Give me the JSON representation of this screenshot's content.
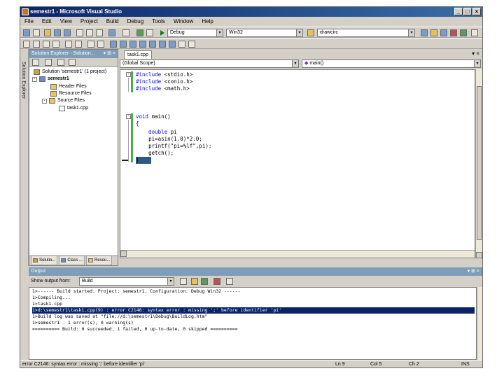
{
  "window": {
    "title": "semestr1 - Microsoft Visual Studio",
    "minimize": "_",
    "maximize": "□",
    "close": "×"
  },
  "menu": [
    "File",
    "Edit",
    "View",
    "Project",
    "Build",
    "Debug",
    "Tools",
    "Window",
    "Help"
  ],
  "toolbar": {
    "configuration": "Debug",
    "platform": "Win32",
    "find_value": "drawcirc"
  },
  "sidebar_tab": "Solution Explorer",
  "solution_explorer": {
    "title": "Solution Explorer - Solution...",
    "title_controls": "▾ ⊞ ×",
    "items": [
      {
        "label": "Solution 'semestr1' (1 project)",
        "icon": "solution-icon"
      },
      {
        "label": "semestr1",
        "icon": "project-icon"
      },
      {
        "label": "Header Files",
        "icon": "folder-icon"
      },
      {
        "label": "Resource Files",
        "icon": "folder-icon"
      },
      {
        "label": "Source Files",
        "icon": "folder-icon"
      },
      {
        "label": "task1.cpp",
        "icon": "cpp-file-icon"
      }
    ],
    "tabs": [
      "Solutio...",
      "Class ...",
      "Resou..."
    ]
  },
  "editor": {
    "tab": "task1.cpp",
    "scope": "(Global Scope)",
    "member": "main()",
    "lines": [
      [
        "#include ",
        "<stdio.h>"
      ],
      [
        "#include ",
        "<conio.h>"
      ],
      [
        "#include ",
        "<math.h>"
      ],
      [
        "void ",
        "main()"
      ],
      [
        "{",
        ""
      ],
      [
        "    double ",
        "pi"
      ],
      [
        "    ",
        "pi=asin(1.0)*2.0;"
      ],
      [
        "    ",
        "printf(\"pi=%lf\",pi);"
      ],
      [
        "    ",
        "getch();"
      ],
      [
        "}",
        ""
      ]
    ]
  },
  "output": {
    "title": "Output",
    "show_output_from_label": "Show output from:",
    "source": "Build",
    "lines": [
      "1>------ Build started: Project: semestr1, Configuration: Debug Win32 ------",
      "1>Compiling...",
      "1>task1.cpp",
      "1>d:\\semestr1\\task1.cpp(9) : error C2146: syntax error : missing ';' before identifier 'pi'",
      "1>Build log was saved at \"file://d:\\semestr1\\Debug\\BuildLog.htm\"",
      "1>semestr1 - 1 error(s), 0 warning(s)",
      "========== Build: 0 succeeded, 1 failed, 0 up-to-date, 0 skipped =========="
    ]
  },
  "status": {
    "message": "error C2146: syntax error : missing ';' before identifier 'pi'",
    "line": "Ln 9",
    "col": "Col 5",
    "ch": "Ch 2",
    "mode": "INS"
  }
}
